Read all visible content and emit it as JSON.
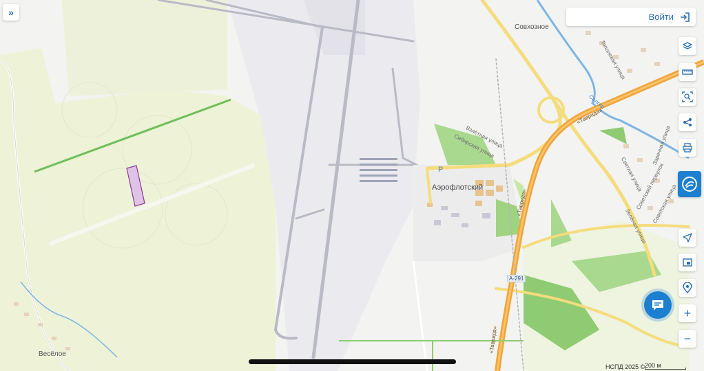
{
  "header": {
    "expand_icon": "double-chevron-right-icon",
    "login_label": "Войти",
    "login_icon": "login-arrow-icon"
  },
  "toolbar": {
    "items": [
      {
        "name": "layers-button",
        "icon": "layers-icon"
      },
      {
        "name": "ruler-button",
        "icon": "ruler-icon"
      },
      {
        "name": "area-select-button",
        "icon": "area-select-icon"
      },
      {
        "name": "share-button",
        "icon": "share-icon"
      },
      {
        "name": "print-button",
        "icon": "printer-icon"
      },
      {
        "name": "service-button",
        "icon": "service-logo-icon"
      },
      {
        "name": "my-location-button",
        "icon": "navigation-arrow-icon"
      },
      {
        "name": "minimap-button",
        "icon": "minimap-icon"
      },
      {
        "name": "geo-search-button",
        "icon": "geo-pin-icon"
      },
      {
        "name": "zoom-in-button",
        "icon": "plus-icon"
      },
      {
        "name": "zoom-out-button",
        "icon": "minus-icon"
      }
    ]
  },
  "chat_button_icon": "chat-bubble-icon",
  "map": {
    "places": {
      "sovkhoznoe": "Совхозное",
      "aeroflotsky": "Аэрофлотский",
      "veseloe": "Весёлое"
    },
    "streets": {
      "vzletnaya": "Взлётная улица",
      "sibirskaya": "Сибирская улица",
      "taurida_1": "«Таврида»",
      "taurida_2": "«Таврида»",
      "taurida_3": "«Таврида»",
      "topolevaya": "Тополевая улица",
      "svetlaya": "Светлая улица",
      "sovetsky_per": "Советский переулок",
      "sovetskaya": "Советская улица",
      "zelenaya": "Зелёная улица",
      "zarechnaya": "Заречная улица",
      "salgir": "Салгир"
    },
    "road_code": "А-291",
    "parking": "P"
  },
  "footer": {
    "attribution": "НСПД 2025 ©",
    "scale_label": "200 м"
  },
  "colors": {
    "highway": "#f1a43a",
    "road_yellow": "#f5dc7d",
    "runway": "#b9bac6",
    "parcel_fill": "#dfc3e6",
    "parcel_stroke": "#8a3a9a",
    "accent": "#1d7fd0",
    "field_green": "#eef2d7"
  }
}
